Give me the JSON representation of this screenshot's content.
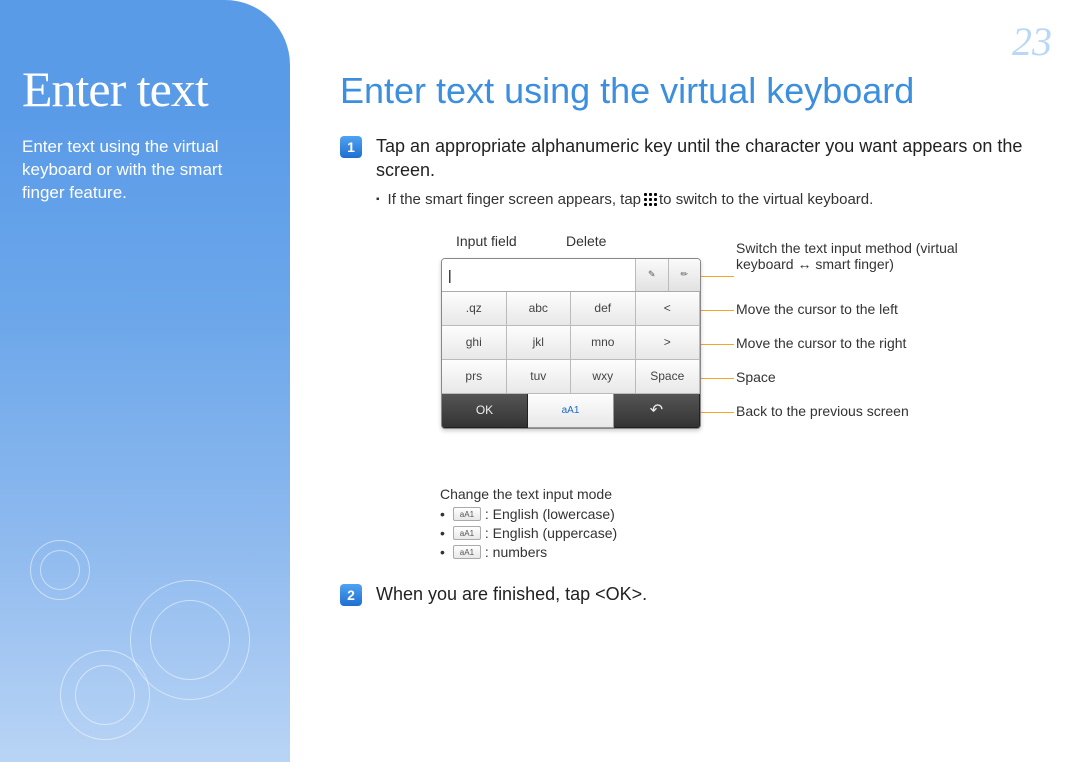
{
  "page_number": "23",
  "sidebar": {
    "title": "Enter text",
    "desc": "Enter text using the virtual keyboard or with the smart finger feature."
  },
  "main": {
    "title": "Enter text using the virtual keyboard",
    "step1": {
      "num": "1",
      "text": "Tap an appropriate alphanumeric key until the character you want appears on the screen.",
      "sub_before": "If the smart finger screen appears, tap ",
      "sub_after": " to switch to the virtual keyboard."
    },
    "labels": {
      "input_field": "Input field",
      "delete": "Delete",
      "switch": "Switch the text input method (virtual keyboard ↔ smart finger)",
      "move_left": "Move the cursor to the left",
      "move_right": "Move the cursor to the right",
      "space": "Space",
      "back": "Back to the previous screen"
    },
    "keyboard": {
      "del": "DEL",
      "row1": [
        ".qz",
        "abc",
        "def",
        "<"
      ],
      "row2": [
        "ghi",
        "jkl",
        "mno",
        ">"
      ],
      "row3": [
        "prs",
        "tuv",
        "wxy",
        "Space"
      ],
      "bottom": {
        "ok": "OK",
        "mode": "aA1",
        "back": "↶"
      }
    },
    "modes": {
      "title": "Change the text input mode",
      "items": [
        {
          "chip": "aA1",
          "label": ": English (lowercase)"
        },
        {
          "chip": "aA1",
          "label": ": English (uppercase)"
        },
        {
          "chip": "aA1",
          "label": ": numbers"
        }
      ]
    },
    "step2": {
      "num": "2",
      "text": "When you are finished, tap <OK>."
    }
  }
}
